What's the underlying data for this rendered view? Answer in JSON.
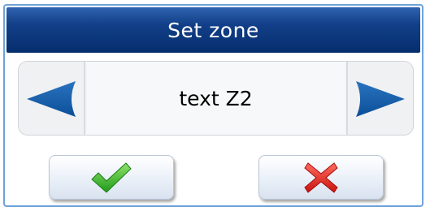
{
  "dialog": {
    "title": "Set zone",
    "zone_value": "text Z2"
  },
  "icons": {
    "prev": "left-arrow-icon",
    "next": "right-arrow-icon",
    "ok": "checkmark-icon",
    "cancel": "x-icon"
  },
  "colors": {
    "title_bar": "#0a3576",
    "arrow": "#0d58a6",
    "check": "#35b52a",
    "cross": "#e0221d"
  }
}
